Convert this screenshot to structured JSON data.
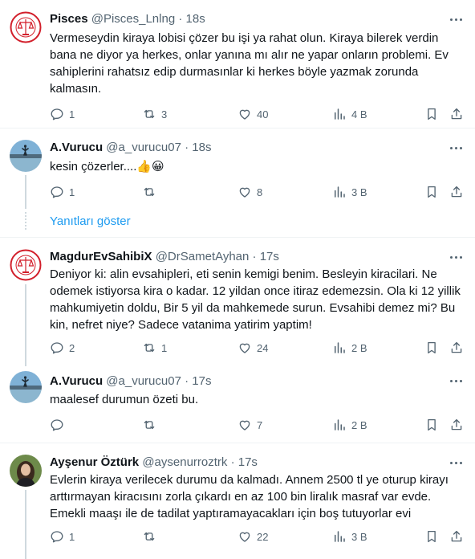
{
  "feed": {
    "show_replies_label": "Yanıtları göster",
    "accent_color": "#1d9bf0",
    "tweets": [
      {
        "name": "Pisces",
        "handle": "@Pisces_Lnlng",
        "separator": "·",
        "time": "18s",
        "avatar": "seal-logo",
        "text": "Vermeseydin kiraya lobisi çözer bu işi ya rahat olun. Kiraya bilerek verdin bana ne diyor ya herkes, onlar yanına mı alır ne yapar onların problemi. Ev sahiplerini rahatsız edip durmasınlar ki herkes böyle yazmak zorunda kalmasın.",
        "replies": "1",
        "retweets": "3",
        "likes": "40",
        "views": "4 B"
      },
      {
        "name": "A.Vurucu",
        "handle": "@a_vurucu07",
        "separator": "·",
        "time": "18s",
        "avatar": "lake-photo",
        "text": "kesin çözerler....👍😀",
        "replies": "1",
        "retweets": "",
        "likes": "8",
        "views": "3 B"
      },
      {
        "name": "MagdurEvSahibiX",
        "handle": "@DrSametAyhan",
        "separator": "·",
        "time": "17s",
        "avatar": "seal-logo",
        "text": "Deniyor ki: alin evsahipleri, eti senin kemigi benim. Besleyin kiracilari. Ne odemek istiyorsa kira o kadar. 12 yildan once itiraz edemezsin. Ola ki 12 yillik mahkumiyetin doldu, Bir 5 yil da mahkemede surun. Evsahibi demez mi? Bu kin, nefret niye? Sadece vatanima yatirim yaptim!",
        "replies": "2",
        "retweets": "1",
        "likes": "24",
        "views": "2 B"
      },
      {
        "name": "A.Vurucu",
        "handle": "@a_vurucu07",
        "separator": "·",
        "time": "17s",
        "avatar": "lake-photo",
        "text": "maalesef durumun özeti bu.",
        "replies": "",
        "retweets": "",
        "likes": "7",
        "views": "2 B"
      },
      {
        "name": "Ayşenur Öztürk",
        "handle": "@aysenurroztrk",
        "separator": "·",
        "time": "17s",
        "avatar": "portrait-photo",
        "text": "Evlerin kiraya verilecek durumu da kalmadı. Annem 2500 tl ye oturup kirayı arttırmayan kiracısını zorla çıkardı en az 100 bin liralık masraf var evde. Emekli maaşı ile de tadilat yaptıramayacakları için boş tutuyorlar evi",
        "replies": "1",
        "retweets": "",
        "likes": "22",
        "views": "3 B"
      }
    ]
  }
}
